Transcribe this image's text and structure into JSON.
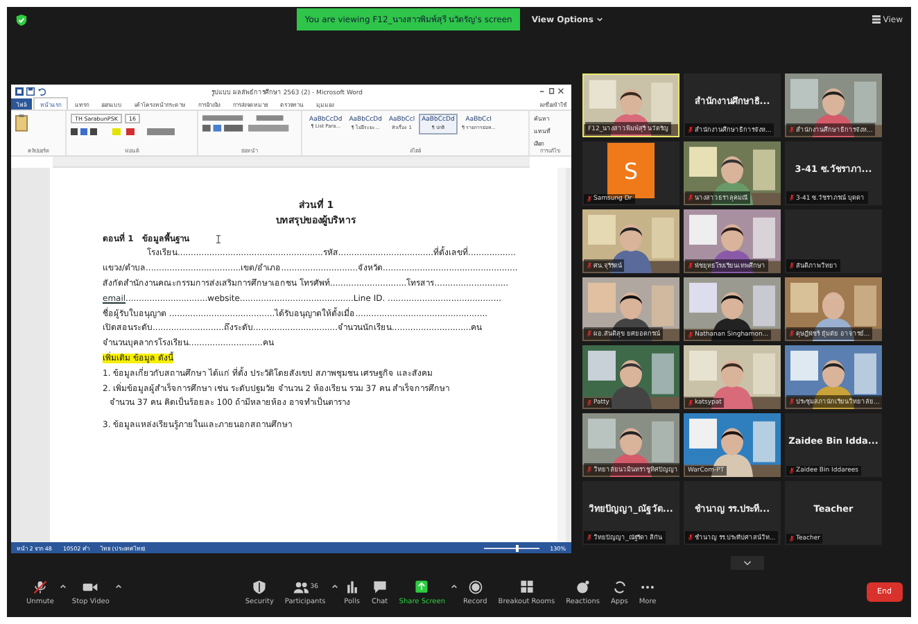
{
  "top_bar": {
    "banner": "You are viewing F12_นางสาวพิมพ์สุรี นวัตรัญ's screen",
    "view_options": "View Options",
    "view": "View"
  },
  "word": {
    "title": "รูปแบบ ผลลัพธ์การศึกษา 2563 (2) - Microsoft Word",
    "account": "ลงชื่อเข้าใช้",
    "tabs": [
      {
        "label": "ไฟล์",
        "kind": "file",
        "selected": false
      },
      {
        "label": "หน้าแรก",
        "kind": "tab",
        "selected": true
      },
      {
        "label": "แทรก",
        "kind": "tab",
        "selected": false
      },
      {
        "label": "ออกแบบ",
        "kind": "tab",
        "selected": false
      },
      {
        "label": "เค้าโครงหน้ากระดาษ",
        "kind": "tab",
        "selected": false
      },
      {
        "label": "การอ้างอิง",
        "kind": "tab",
        "selected": false
      },
      {
        "label": "การส่งจดหมาย",
        "kind": "tab",
        "selected": false
      },
      {
        "label": "ตรวจทาน",
        "kind": "tab",
        "selected": false
      },
      {
        "label": "มุมมอง",
        "kind": "tab",
        "selected": false
      }
    ],
    "font_name": "TH SarabunPSK",
    "font_size": "16",
    "styles": [
      {
        "sample": "AaBbCcDd",
        "name": "¶ List Para...",
        "selected": false
      },
      {
        "sample": "AaBbCcDd",
        "name": "¶ ไม่มีระยะ...",
        "selected": false
      },
      {
        "sample": "AaBbCcl",
        "name": "หัวเรื่อง 1",
        "selected": false
      },
      {
        "sample": "AaBbCcDd",
        "name": "¶ ปกติ",
        "selected": true
      },
      {
        "sample": "AaBbCcI",
        "name": "¶ รายการย่อห...",
        "selected": false
      }
    ],
    "editing": [
      "ค้นหา",
      "แทนที่",
      "เลือก"
    ],
    "groups": [
      "คลิปบอร์ด",
      "ฟอนต์",
      "ย่อหน้า",
      "สไตล์",
      "การแก้ไข"
    ],
    "doc": {
      "heading": "ส่วนที่ 1",
      "subheading": "บทสรุปของผู้บริหาร",
      "section_number": "ตอนที่ 1",
      "section_title": "ข้อมูลพื้นฐาน",
      "lines": [
        {
          "kind": "indent",
          "text": "โรงเรียน.......................................................รหัส....................................ที่ตั้งเลขที่.................."
        },
        {
          "kind": "plain",
          "text": "แขวง/ตำบล....................................เขต/อำเภอ.............................จังหวัด..................................................."
        },
        {
          "kind": "plain",
          "text": "สังกัดสำนักงานคณะกรรมการส่งเสริมการศึกษาเอกชน โทรศัพท์.............................โทรสาร............................"
        },
        {
          "kind": "link",
          "link": "email",
          "text": "...............................website...........................................Line ID. ..........................................."
        },
        {
          "kind": "plain",
          "text": "ชื่อผู้รับใบอนุญาต ........................................ได้รับอนุญาตให้ตั้งเมื่อ.................................................."
        },
        {
          "kind": "plain",
          "text": "เปิดสอนระดับ...........................ถึงระดับ................................จำนวนนักเรียน..............................คน"
        },
        {
          "kind": "plain",
          "text": "จำนวนบุคลากรโรงเรียน............................คน"
        },
        {
          "kind": "highlight",
          "text": "เพิ่มเติม ข้อมูล ดังนี้"
        },
        {
          "kind": "plain",
          "text": "1. ข้อมูลเกี่ยวกับสถานศึกษา ได้แก่ ที่ตั้ง ประวัติโดยสังเขป สภาพชุมชน เศรษฐกิจ และสังคม"
        },
        {
          "kind": "plain",
          "text": "2. เพิ่มข้อมูลผู้สำเร็จการศึกษา เช่น ระดับปฐมวัย จำนวน 2 ห้องเรียน  รวม 37 คน สำเร็จการศึกษา"
        },
        {
          "kind": "cont",
          "text": "จำนวน  37 คน  คิดเป็นร้อยละ 100  ถ้ามีหลายห้อง อาจทำเป็นตาราง"
        },
        {
          "kind": "gap",
          "text": "3. ข้อมูลแหล่งเรียนรู้ภายในและภายนอกสถานศึกษา"
        }
      ]
    },
    "status": {
      "page": "หน้า 2 จาก 48",
      "words": "10502 คำ",
      "language": "ไทย (ประเทศไทย)",
      "zoom": "130%",
      "level": 0.6
    }
  },
  "tiles": [
    {
      "kind": "video",
      "name": "F12_นางสาวพิมพ์สุรี นวัตรัญ",
      "muted": false,
      "speaking": true
    },
    {
      "kind": "name",
      "title": "สำนักงานศึกษาธิ...",
      "name": "สำนักงานศึกษาธิการจังห...",
      "muted": true,
      "speaking": false
    },
    {
      "kind": "video",
      "name": "สำนักงานศึกษาธิการจังห...",
      "muted": true,
      "speaking": false
    },
    {
      "kind": "avatar",
      "initial": "S",
      "name": "Samsung Dr",
      "muted": true,
      "speaking": false
    },
    {
      "kind": "video",
      "name": "นางสาวธราลุคมณี",
      "muted": true,
      "speaking": false
    },
    {
      "kind": "name",
      "title": "3-41 ซ.วัชราภา...",
      "name": "3-41 ซ.วัชราภรณ์ บุดดา",
      "muted": true,
      "speaking": false
    },
    {
      "kind": "video",
      "name": "ศน.จุรีรัตน์",
      "muted": true,
      "speaking": false
    },
    {
      "kind": "video",
      "name": "พัชยุทธโรงเรียนเทพศึกษา",
      "muted": true,
      "speaking": false
    },
    {
      "kind": "blank",
      "name": "สันติภาพวิทยา",
      "muted": true,
      "speaking": false
    },
    {
      "kind": "video",
      "name": "ผอ.สันติสุข ยศยอดกรณ์",
      "muted": true,
      "speaking": false
    },
    {
      "kind": "video",
      "name": "Nathanan Singhamon...",
      "muted": true,
      "speaking": false
    },
    {
      "kind": "video",
      "name": "ดุษฎีพัชร์ ยุ้มดัย อาจารย์...",
      "muted": true,
      "speaking": false
    },
    {
      "kind": "video",
      "name": "Patty",
      "muted": true,
      "speaking": false
    },
    {
      "kind": "video",
      "name": "katsypat",
      "muted": true,
      "speaking": false
    },
    {
      "kind": "video",
      "name": "ประชุมสภานักเรียนวิทยาลัย...",
      "muted": true,
      "speaking": false
    },
    {
      "kind": "video",
      "name": "วิทยาลัยนวมินทราชูทิศปัญญา",
      "muted": true,
      "speaking": false
    },
    {
      "kind": "video",
      "name": "WarCom-PT",
      "muted": false,
      "speaking": false
    },
    {
      "kind": "name",
      "title": "Zaidee Bin Idda...",
      "name": "Zaidee Bin Iddarees",
      "muted": true,
      "speaking": false
    },
    {
      "kind": "name",
      "title": "วิทยปัญญา_ณัฐวัต...",
      "name": "วิทยปัญญา_ณัฐรีดา สิกัน",
      "muted": true,
      "speaking": false
    },
    {
      "kind": "name",
      "title": "ชำนาญ รร.ประที...",
      "name": "ชำนาญ รร.ประทีปศาสน์วิท...",
      "muted": true,
      "speaking": false
    },
    {
      "kind": "name",
      "title": "Teacher",
      "name": "Teacher",
      "muted": true,
      "speaking": false
    }
  ],
  "toolbar": [
    {
      "kind": "mic",
      "label": "Unmute",
      "caret": true
    },
    {
      "kind": "video",
      "label": "Stop Video",
      "caret": true
    },
    {
      "kind": "security",
      "label": "Security",
      "caret": false
    },
    {
      "kind": "participants",
      "label": "Participants",
      "count": "36",
      "caret": true
    },
    {
      "kind": "polls",
      "label": "Polls",
      "caret": false
    },
    {
      "kind": "chat",
      "label": "Chat",
      "caret": false
    },
    {
      "kind": "share",
      "label": "Share Screen",
      "caret": true
    },
    {
      "kind": "record",
      "label": "Record",
      "caret": false
    },
    {
      "kind": "breakout",
      "label": "Breakout Rooms",
      "caret": false
    },
    {
      "kind": "reactions",
      "label": "Reactions",
      "caret": false
    },
    {
      "kind": "apps",
      "label": "Apps",
      "caret": false
    },
    {
      "kind": "more",
      "label": "More",
      "caret": false
    }
  ],
  "end_button": "End"
}
